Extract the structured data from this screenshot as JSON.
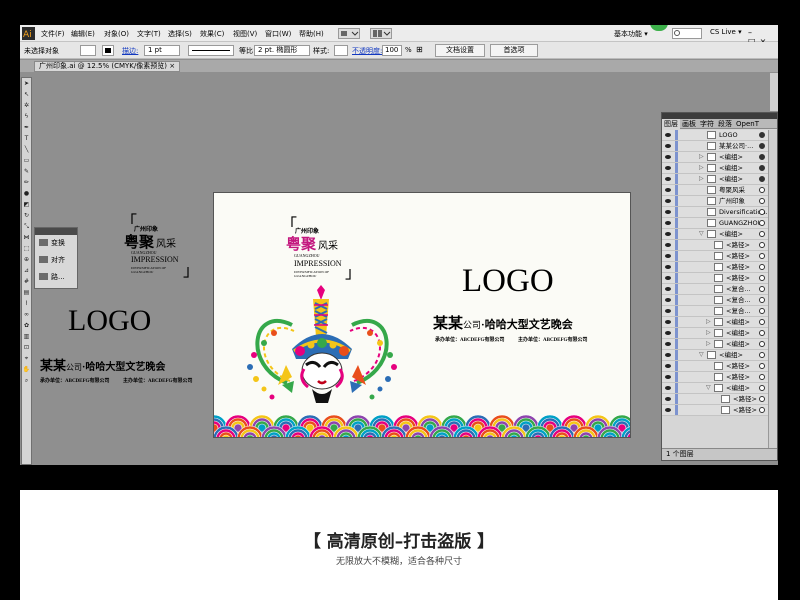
{
  "menu": {
    "items": [
      "文件(F)",
      "编辑(E)",
      "对象(O)",
      "文字(T)",
      "选择(S)",
      "效果(C)",
      "视图(V)",
      "窗口(W)",
      "帮助(H)"
    ],
    "workspace": "基本功能 ▾",
    "cslive": "CS Live ▾"
  },
  "controlbar": {
    "no_selection": "未选择对象",
    "stroke_label": "描边:",
    "stroke_value": "1 pt",
    "uniform": "等比",
    "brush_value": "2 pt. 椭圆形",
    "style_label": "样式:",
    "opacity_label": "不透明度:",
    "opacity_value": "100",
    "opacity_unit": "%",
    "doc_setup": "文档设置",
    "preferences": "首选项"
  },
  "document": {
    "tab_title": "广州印象.ai @ 12.5% (CMYK/像素预览)",
    "tab_close": "×"
  },
  "float_panel": {
    "items": [
      "变换",
      "对齐",
      "路..."
    ]
  },
  "artwork": {
    "guangzhou_yinxiang": "广州印象",
    "yue_ju": "粤聚",
    "feng_cai": "风采",
    "guangzhou_en": "GUANGZHOU",
    "impression": "IMPRESSION",
    "diversification": "DIVERSIFICATION OF",
    "guangzhou_small": "GUANGZHOU",
    "logo": "LOGO",
    "company_big": "某某",
    "company_small": "公司",
    "event_title": "·哈哈大型文艺晚会",
    "organizer": "承办单位：ABCDEFG有限公司",
    "host": "主办单位：ABCDEFG有限公司",
    "bracket_open": "「",
    "bracket_close": "」"
  },
  "layers_panel": {
    "tabs": [
      "图层",
      "画板",
      "字符",
      "段落",
      "OpenT"
    ],
    "active_tab": "图层",
    "rows": [
      {
        "name": "LOGO",
        "indent": 0,
        "toggle": "",
        "target": "filled"
      },
      {
        "name": "某某公司·...",
        "indent": 0,
        "toggle": "",
        "target": "filled"
      },
      {
        "name": "<编组>",
        "indent": 0,
        "toggle": "▷",
        "target": "filled"
      },
      {
        "name": "<编组>",
        "indent": 0,
        "toggle": "▷",
        "target": "filled"
      },
      {
        "name": "<编组>",
        "indent": 0,
        "toggle": "▷",
        "target": "filled"
      },
      {
        "name": "粤聚风采",
        "indent": 0,
        "toggle": "",
        "target": "empty"
      },
      {
        "name": "广州印象",
        "indent": 0,
        "toggle": "",
        "target": "empty"
      },
      {
        "name": "Diversification...",
        "indent": 0,
        "toggle": "",
        "target": "empty"
      },
      {
        "name": "GUANGZHOU",
        "indent": 0,
        "toggle": "",
        "target": "empty"
      },
      {
        "name": "<编组>",
        "indent": 0,
        "toggle": "▽",
        "target": "empty"
      },
      {
        "name": "<路径>",
        "indent": 1,
        "toggle": "",
        "target": "empty"
      },
      {
        "name": "<路径>",
        "indent": 1,
        "toggle": "",
        "target": "empty"
      },
      {
        "name": "<路径>",
        "indent": 1,
        "toggle": "",
        "target": "empty"
      },
      {
        "name": "<路径>",
        "indent": 1,
        "toggle": "",
        "target": "empty"
      },
      {
        "name": "<复合...",
        "indent": 1,
        "toggle": "",
        "target": "empty"
      },
      {
        "name": "<复合...",
        "indent": 1,
        "toggle": "",
        "target": "empty"
      },
      {
        "name": "<复合...",
        "indent": 1,
        "toggle": "",
        "target": "empty"
      },
      {
        "name": "<编组>",
        "indent": 1,
        "toggle": "▷",
        "target": "empty"
      },
      {
        "name": "<编组>",
        "indent": 1,
        "toggle": "▷",
        "target": "empty"
      },
      {
        "name": "<编组>",
        "indent": 1,
        "toggle": "▷",
        "target": "empty"
      },
      {
        "name": "<编组>",
        "indent": 0,
        "toggle": "▽",
        "target": "empty"
      },
      {
        "name": "<路径>",
        "indent": 1,
        "toggle": "",
        "target": "empty"
      },
      {
        "name": "<路径>",
        "indent": 1,
        "toggle": "",
        "target": "empty"
      },
      {
        "name": "<编组>",
        "indent": 1,
        "toggle": "▽",
        "target": "empty"
      },
      {
        "name": "<路径>",
        "indent": 2,
        "toggle": "",
        "target": "empty"
      },
      {
        "name": "<路径>",
        "indent": 2,
        "toggle": "",
        "target": "empty"
      }
    ],
    "footer": "1 个图层"
  },
  "banner": {
    "title": "【 高清原创–打击盗版 】",
    "subtitle": "无限放大不模糊，适合各种尺寸"
  },
  "colors": {
    "workspace_bg": "#8f8f8f",
    "artboard_bg": "#fbfbf6",
    "layer_highlight": "#7d93cf",
    "accent_magenta": "#c3177e",
    "accent_green": "#35a84a"
  }
}
